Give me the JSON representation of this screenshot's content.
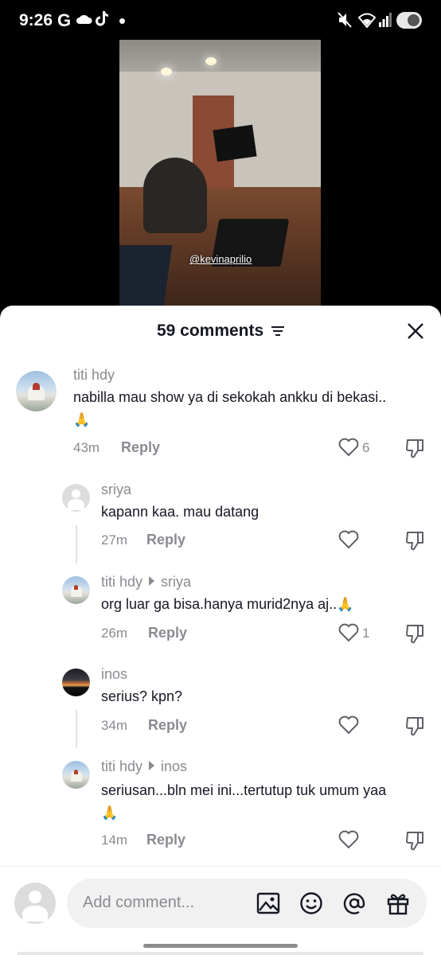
{
  "status_bar": {
    "time": "9:26",
    "google_letter": "G",
    "icons": [
      "cloud-icon",
      "tiktok-icon",
      "notification-dot",
      "mute-icon",
      "wifi-icon",
      "signal-icon",
      "battery-toggle"
    ]
  },
  "video": {
    "watermark": "@kevinaprilio"
  },
  "sheet": {
    "title": "59 comments",
    "close_icon": "close-icon",
    "filter_icon": "filter-icon"
  },
  "comments": [
    {
      "name": "titi hdy",
      "reply_to": "",
      "text": "nabilla mau show ya di sekokah ankku di bekasi..",
      "emoji": "🙏",
      "time": "43m",
      "reply_label": "Reply",
      "likes": "6",
      "avatar": "city"
    },
    {
      "name": "sriya",
      "reply_to": "",
      "text": "kapann kaa. mau datang",
      "emoji": "",
      "time": "27m",
      "reply_label": "Reply",
      "likes": "",
      "avatar": "default"
    },
    {
      "name": "titi hdy",
      "reply_to": "sriya",
      "text": "org luar ga bisa.hanya murid2nya aj..",
      "emoji": "🙏",
      "time": "26m",
      "reply_label": "Reply",
      "likes": "1",
      "avatar": "city"
    },
    {
      "name": "inos",
      "reply_to": "",
      "text": "serius? kpn?",
      "emoji": "",
      "time": "34m",
      "reply_label": "Reply",
      "likes": "",
      "avatar": "sunset"
    },
    {
      "name": "titi hdy",
      "reply_to": "inos",
      "text": "seriusan...bln mei ini...tertutup tuk umum yaa",
      "emoji": "🙏",
      "time": "14m",
      "reply_label": "Reply",
      "likes": "",
      "avatar": "city"
    }
  ],
  "composer": {
    "placeholder": "Add comment...",
    "icons": [
      "image-icon",
      "emoji-icon",
      "mention-icon",
      "gift-icon"
    ]
  }
}
